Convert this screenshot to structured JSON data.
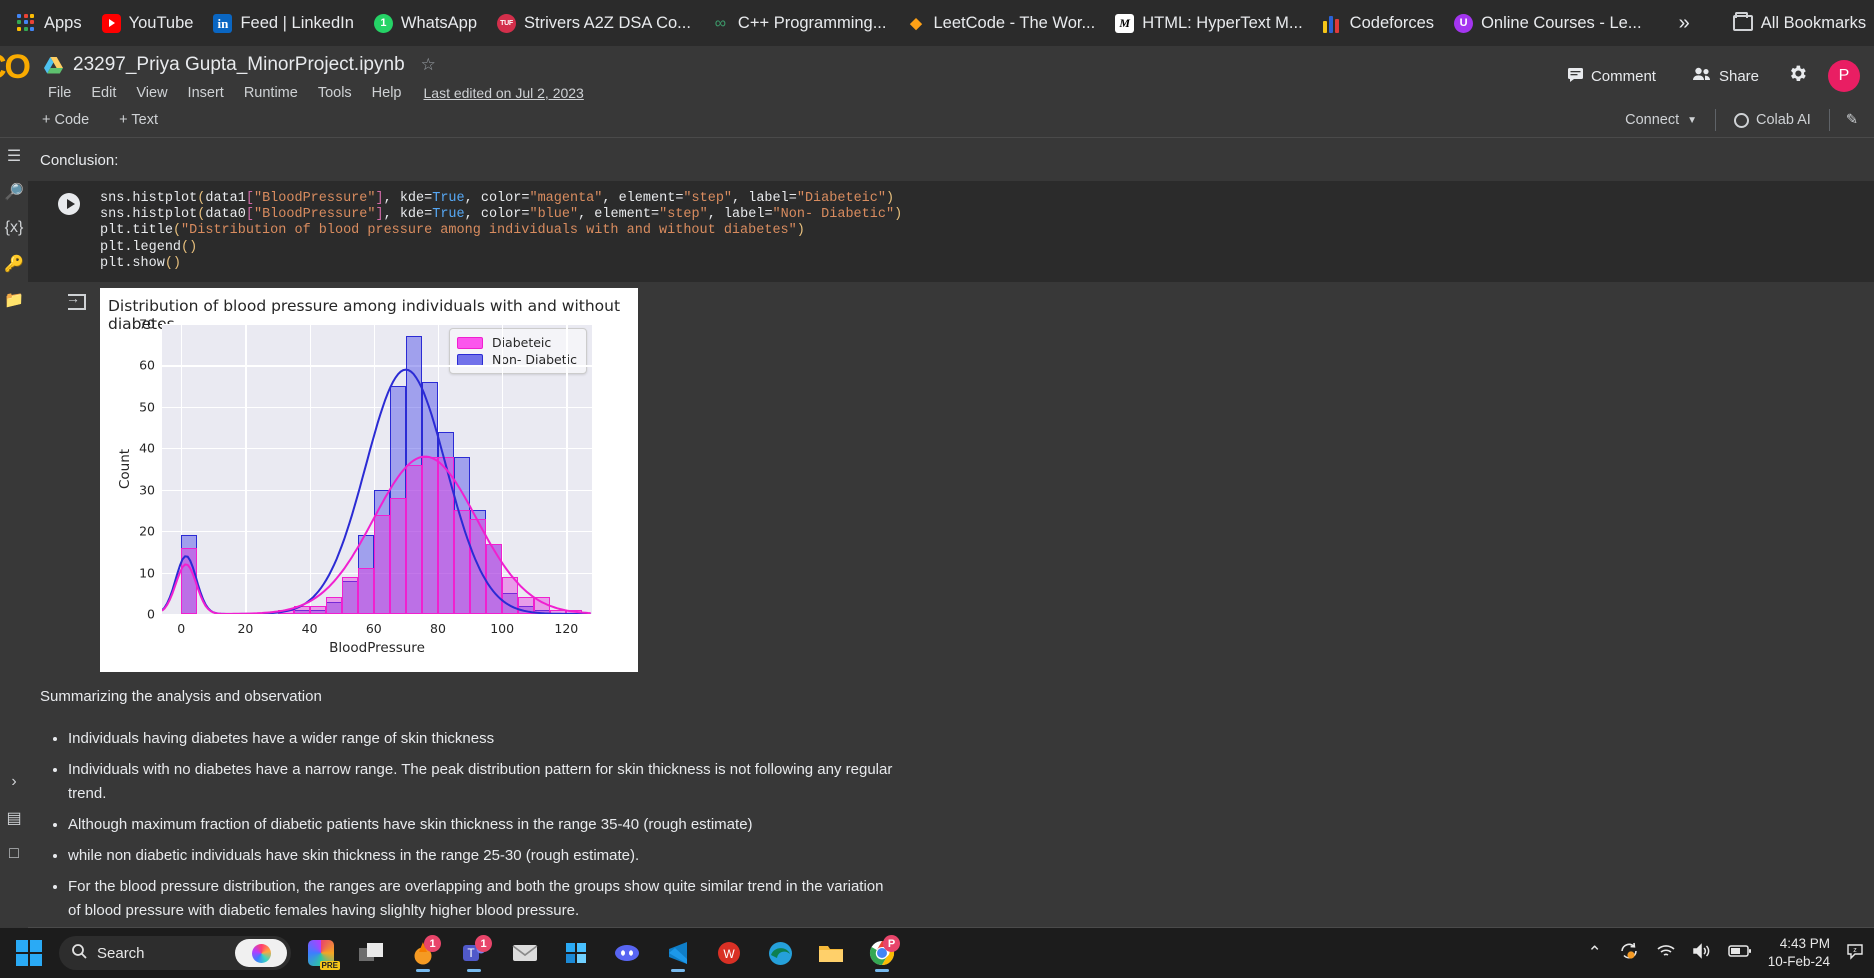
{
  "browser": {
    "bookmarks": [
      {
        "label": "Apps",
        "icon": "apps-grid-icon"
      },
      {
        "label": "YouTube",
        "icon": "youtube-icon"
      },
      {
        "label": "Feed | LinkedIn",
        "icon": "linkedin-icon"
      },
      {
        "label": "WhatsApp",
        "icon": "whatsapp-icon"
      },
      {
        "label": "Strivers A2Z DSA Co...",
        "icon": "takeuforward-icon"
      },
      {
        "label": "C++ Programming...",
        "icon": "cpp-icon"
      },
      {
        "label": "LeetCode - The Wor...",
        "icon": "leetcode-icon"
      },
      {
        "label": "HTML: HyperText M...",
        "icon": "mdn-icon"
      },
      {
        "label": "Codeforces",
        "icon": "codeforces-icon"
      },
      {
        "label": "Online Courses - Le...",
        "icon": "udemy-icon"
      }
    ],
    "overflow_label": "»",
    "all_bookmarks_label": "All Bookmarks"
  },
  "colab": {
    "logo_text": "CO",
    "notebook_title": "23297_Priya Gupta_MinorProject.ipynb",
    "star_glyph": "☆",
    "menu": [
      "File",
      "Edit",
      "View",
      "Insert",
      "Runtime",
      "Tools",
      "Help"
    ],
    "last_edited": "Last edited on Jul 2, 2023",
    "comment_label": "Comment",
    "share_label": "Share",
    "settings_icon": "gear-icon",
    "avatar_initial": "P",
    "toolbar": {
      "add_code": "+ Code",
      "add_text": "+ Text",
      "connect_label": "Connect",
      "colab_ai_label": "Colab AI"
    }
  },
  "notebook": {
    "conclusion_text": "Conclusion:",
    "code_lines": [
      "sns.histplot(data1[\"BloodPressure\"], kde=True, color=\"magenta\", element=\"step\", label=\"Diabeteic\")",
      "sns.histplot(data0[\"BloodPressure\"], kde=True, color=\"blue\", element=\"step\", label=\"Non- Diabetic\")",
      "plt.title(\"Distribution of blood pressure among individuals with and without diabetes\")",
      "plt.legend()",
      "plt.show()"
    ],
    "summary_heading": "Summarizing the analysis and observation",
    "bullets": [
      "Individuals having diabetes have a wider range of skin thickness",
      "Individuals with no diabetes have a narrow range. The peak distribution pattern for skin thickness is not following any regular trend.",
      "Although maximum fraction of diabetic patients have skin thickness in the range 35-40 (rough estimate)",
      "while non diabetic individuals have skin thickness in the range 25-30 (rough estimate).",
      "For the blood pressure distribution, the ranges are overlapping and both the groups show quite similar trend in the variation of blood pressure with diabetic females having slighlty higher blood pressure."
    ]
  },
  "chart_data": {
    "type": "bar",
    "title": "Distribution of blood pressure among individuals with and without diabetes",
    "xlabel": "BloodPressure",
    "ylabel": "Count",
    "xlim": [
      -6,
      128
    ],
    "ylim": [
      0,
      70
    ],
    "xticks": [
      0,
      20,
      40,
      60,
      80,
      100,
      120
    ],
    "yticks": [
      0,
      10,
      20,
      30,
      40,
      50,
      60,
      70
    ],
    "grid": true,
    "legend_position": "upper right",
    "colors": {
      "diabetic": "#f020d0",
      "non_diabetic": "#2b2bd4"
    },
    "series": [
      {
        "name": "Non- Diabetic",
        "color": "#2b2bd4",
        "bin_width": 5.0,
        "bins_left": [
          0,
          5,
          35,
          40,
          45,
          50,
          55,
          60,
          65,
          70,
          75,
          80,
          85,
          90,
          95,
          100,
          105,
          110
        ],
        "values": [
          19,
          0,
          1,
          1,
          3,
          8,
          19,
          30,
          55,
          67,
          56,
          44,
          38,
          25,
          17,
          5,
          2,
          1
        ]
      },
      {
        "name": "Diabeteic",
        "color": "#f020d0",
        "bin_width": 5.0,
        "bins_left": [
          0,
          5,
          30,
          35,
          40,
          45,
          50,
          55,
          60,
          65,
          70,
          75,
          80,
          85,
          90,
          95,
          100,
          105,
          110,
          115,
          120
        ],
        "values": [
          16,
          0,
          1,
          2,
          2,
          4,
          9,
          11,
          24,
          28,
          36,
          38,
          38,
          25,
          23,
          17,
          9,
          4,
          4,
          1,
          1
        ]
      }
    ],
    "kde_curves": [
      {
        "name": "Non- Diabetic",
        "color": "#2b2bd4",
        "peak_x": 70,
        "peak_y": 59
      },
      {
        "name": "Diabeteic",
        "color": "#f020d0",
        "peak_x": 76,
        "peak_y": 38
      }
    ],
    "legend_entries": [
      "Diabeteic",
      "Non- Diabetic"
    ]
  },
  "taskbar": {
    "search_placeholder": "Search",
    "apps": [
      {
        "name": "windows-start-icon"
      },
      {
        "name": "office-copilot-icon",
        "badge": "PRE"
      },
      {
        "name": "task-view-icon"
      },
      {
        "name": "vlc-icon",
        "badge": "1"
      },
      {
        "name": "teams-icon",
        "badge": "1"
      },
      {
        "name": "mail-icon"
      },
      {
        "name": "store-icon"
      },
      {
        "name": "discord-icon"
      },
      {
        "name": "vscode-icon"
      },
      {
        "name": "wps-office-icon"
      },
      {
        "name": "edge-icon"
      },
      {
        "name": "file-explorer-icon"
      },
      {
        "name": "chrome-icon",
        "badge": "P"
      }
    ],
    "tray": {
      "chevron": "⌃",
      "time": "4:43 PM",
      "date": "10-Feb-24"
    }
  }
}
